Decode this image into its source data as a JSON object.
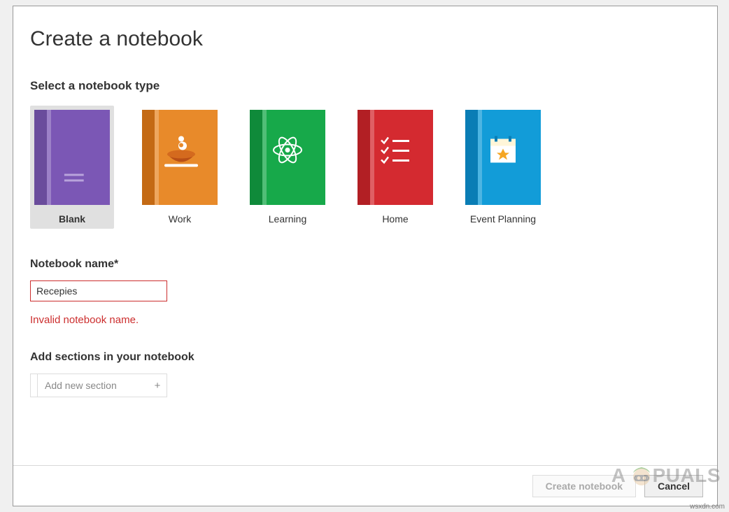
{
  "dialog": {
    "title": "Create a notebook",
    "type_section_label": "Select a notebook type",
    "types": [
      {
        "id": "blank",
        "label": "Blank",
        "selected": true
      },
      {
        "id": "work",
        "label": "Work",
        "selected": false
      },
      {
        "id": "learning",
        "label": "Learning",
        "selected": false
      },
      {
        "id": "home",
        "label": "Home",
        "selected": false
      },
      {
        "id": "event-planning",
        "label": "Event Planning",
        "selected": false
      }
    ],
    "name_field": {
      "label": "Notebook name*",
      "value": "Recepies",
      "error": "Invalid notebook name."
    },
    "sections": {
      "label": "Add sections in your notebook",
      "add_placeholder": "Add new section",
      "plus": "+"
    },
    "footer": {
      "create_label": "Create notebook",
      "create_enabled": false,
      "cancel_label": "Cancel"
    }
  },
  "watermark": {
    "brand_prefix": "A",
    "brand_suffix": "PUALS",
    "site": "wsxdn.com"
  },
  "colors": {
    "error": "#cc2e2e",
    "purple": "#7b57b5",
    "orange": "#e88a2a",
    "green": "#17a94a",
    "red": "#d42a30",
    "blue": "#129cd8"
  }
}
